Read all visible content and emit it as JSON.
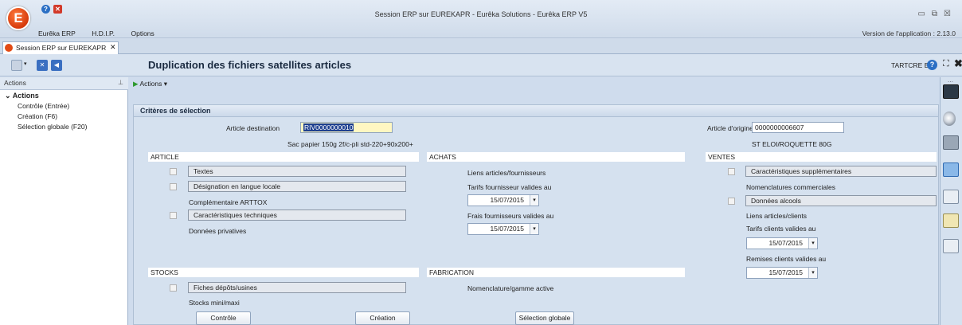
{
  "window": {
    "title": "Session ERP sur EUREKAPR - Eurêka Solutions - Eurêka ERP V5",
    "version": "Version de l'application : 2.13.0",
    "logo_letter": "E",
    "menu": [
      "Eurêka ERP",
      "H.D.I.P.",
      "Options"
    ]
  },
  "tab": {
    "label": "Session ERP sur EUREKAPR",
    "close": "✕"
  },
  "toolbar": {
    "title": "Duplication des fichiers satellites articles",
    "user": "TARTCRE B",
    "help": "?",
    "expand": "⛶",
    "close": "✖"
  },
  "left_panel": {
    "header": "Actions",
    "pin": "⊥",
    "group": "Actions",
    "items": [
      "Contrôle (Entrée)",
      "Création (F6)",
      "Sélection globale (F20)"
    ]
  },
  "actions_bar": {
    "label": "Actions"
  },
  "form": {
    "title": "Critères de sélection",
    "article_destination_label": "Article destination",
    "article_destination_value": "RIV0000000010",
    "article_destination_desc": "Sac papier 150g 2f/c-pli std-220+90x200+",
    "article_origine_label": "Article d'origine",
    "article_origine_value": "0000000006607",
    "article_origine_desc": "ST ELOI/ROQUETTE 80G",
    "sections": {
      "article": "ARTICLE",
      "achats": "ACHATS",
      "ventes": "VENTES",
      "stocks": "STOCKS",
      "fabrication": "FABRICATION"
    },
    "article": {
      "textes": "Textes",
      "designation": "Désignation en langue locale",
      "complementaire": "Complémentaire ARTTOX",
      "caracteristiques": "Caractéristiques techniques",
      "donnees_privatives": "Données privatives"
    },
    "achats": {
      "liens": "Liens articles/fournisseurs",
      "tarifs_label": "Tarifs fournisseur valides au",
      "tarifs_date": "15/07/2015",
      "frais_label": "Frais fournisseurs valides au",
      "frais_date": "15/07/2015"
    },
    "ventes": {
      "caracteristiques_supp": "Caractéristiques supplémentaires",
      "nomenclatures": "Nomenclatures commerciales",
      "alcools": "Données alcools",
      "liens_clients": "Liens articles/clients",
      "tarifs_label": "Tarifs clients valides au",
      "tarifs_date": "15/07/2015",
      "remises_label": "Remises clients valides au",
      "remises_date": "15/07/2015"
    },
    "stocks": {
      "fiches": "Fiches dépôts/usines",
      "mini_maxi": "Stocks mini/maxi"
    },
    "fabrication": {
      "nomenclature": "Nomenclature/gamme active"
    },
    "buttons": {
      "controle": "Contrôle",
      "creation": "Création",
      "selection": "Sélection globale"
    }
  },
  "colors": {
    "accent": "#2b6fc4",
    "logo": "#e24a14",
    "selection": "#1d3f8f",
    "highlight_input": "#fff7c2"
  }
}
